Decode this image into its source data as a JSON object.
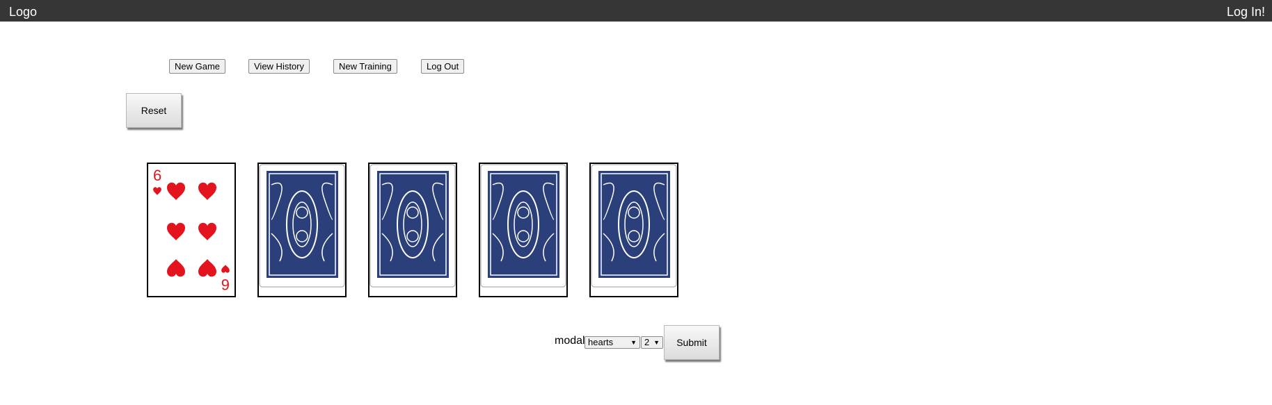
{
  "header": {
    "logo": "Logo",
    "login": "Log In!"
  },
  "nav": {
    "new_game": "New Game",
    "view_history": "View History",
    "new_training": "New Training",
    "log_out": "Log Out"
  },
  "controls": {
    "reset": "Reset"
  },
  "cards": [
    {
      "face": "up",
      "rank": "6",
      "suit": "hearts"
    },
    {
      "face": "down"
    },
    {
      "face": "down"
    },
    {
      "face": "down"
    },
    {
      "face": "down"
    }
  ],
  "guess": {
    "label": "modal",
    "suit_selected": "hearts",
    "rank_selected": "2",
    "submit": "Submit"
  },
  "colors": {
    "header_bg": "#363636",
    "card_back": "#2b3f7a",
    "hearts_red": "#e3141e"
  }
}
